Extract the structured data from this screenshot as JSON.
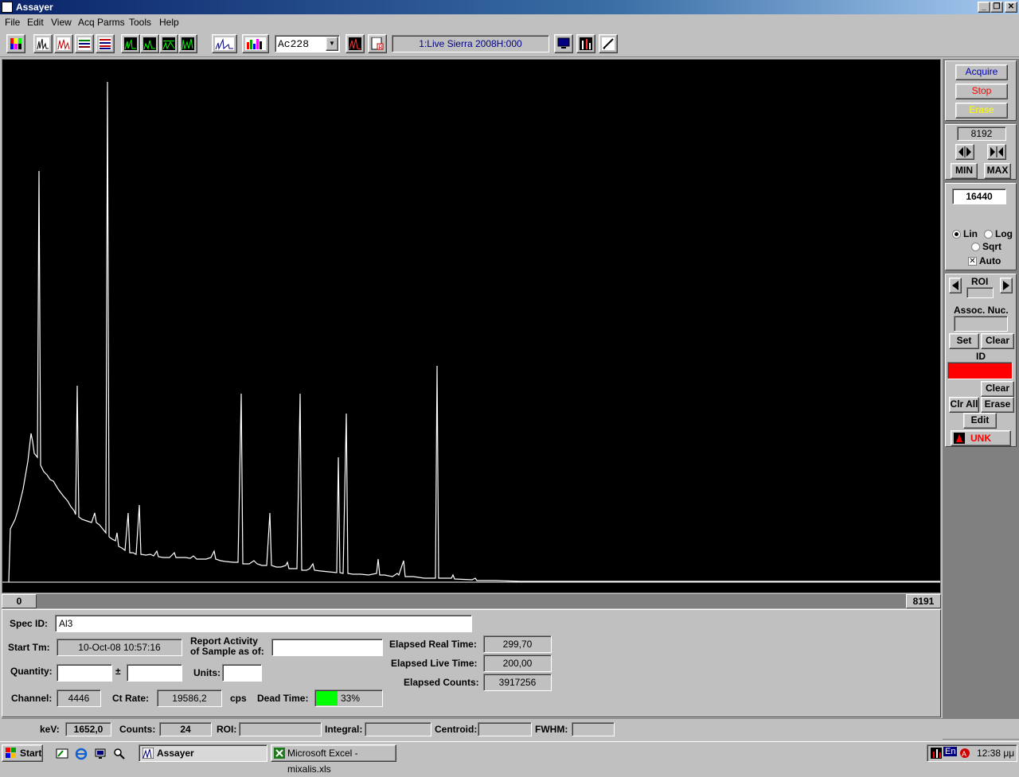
{
  "window": {
    "title": "Assayer"
  },
  "menu": [
    "File",
    "Edit",
    "View",
    "Acq Parms",
    "Tools",
    "Help"
  ],
  "toolbar": {
    "nuclide_select": "Ac228",
    "detector_label": "1:Live  Sierra 2008H:000",
    "icons": [
      "color-palette-icon",
      "spectrum-view-icon",
      "spectrum-compare-icon",
      "bars-icon",
      "list-icon",
      "spectrum-green-1-icon",
      "spectrum-green-2-icon",
      "spectrum-green-3-icon",
      "spectrum-green-4-icon",
      "spectrum-blue-icon",
      "multi-color-icon",
      "peak-icon",
      "report-icon",
      "monitor-icon",
      "chart-tools-icon",
      "pencil-icon"
    ]
  },
  "colors": {
    "detector_bg": "#ff00ff",
    "id_bar": "#ff0000",
    "dead_time": "#00ff00",
    "spectrum_line": "#ffffff"
  },
  "scroll": {
    "min": "0",
    "max": "8191"
  },
  "right_panel": {
    "acquire": "Acquire",
    "stop": "Stop",
    "erase": "Erase",
    "channels": "8192",
    "min": "MIN",
    "max": "MAX",
    "vertical_full_scale": "16440",
    "scale_options": {
      "lin": "Lin",
      "log": "Log",
      "sqrt": "Sqrt",
      "auto": "Auto"
    },
    "roi_label": "ROI",
    "assoc_nuc_label": "Assoc. Nuc.",
    "set": "Set",
    "clear": "Clear",
    "id_label": "ID",
    "clear2": "Clear",
    "clr_all": "Clr All",
    "erase2": "Erase",
    "edit": "Edit",
    "unk": "UNK"
  },
  "info": {
    "spec_id_label": "Spec ID:",
    "spec_id": "Al3",
    "start_tm_label": "Start Tm:",
    "start_tm": "10-Oct-08 10:57:16",
    "report_label_1": "Report Activity",
    "report_label_2": "of Sample as of:",
    "quantity_label": "Quantity:",
    "plusminus": "±",
    "units_label": "Units:",
    "channel_label": "Channel:",
    "channel": "4446",
    "ct_rate_label": "Ct Rate:",
    "ct_rate": "19586,2",
    "cps": "cps",
    "dead_time_label": "Dead Time:",
    "dead_time": "33%",
    "dead_time_fraction": 0.33,
    "elapsed_real_label": "Elapsed Real Time:",
    "elapsed_real": "299,70",
    "elapsed_live_label": "Elapsed Live Time:",
    "elapsed_live": "200,00",
    "elapsed_counts_label": "Elapsed Counts:",
    "elapsed_counts": "3917256"
  },
  "status": {
    "kev_label": "keV:",
    "kev": "1652,0",
    "counts_label": "Counts:",
    "counts": "24",
    "roi_label": "ROI:",
    "integral_label": "Integral:",
    "centroid_label": "Centroid:",
    "fwhm_label": "FWHM:"
  },
  "taskbar": {
    "start": "Start",
    "tasks": [
      "Assayer",
      "Microsoft Excel - mixalis.xls"
    ],
    "tray_lang": "En",
    "clock": "12:38 μμ"
  }
}
